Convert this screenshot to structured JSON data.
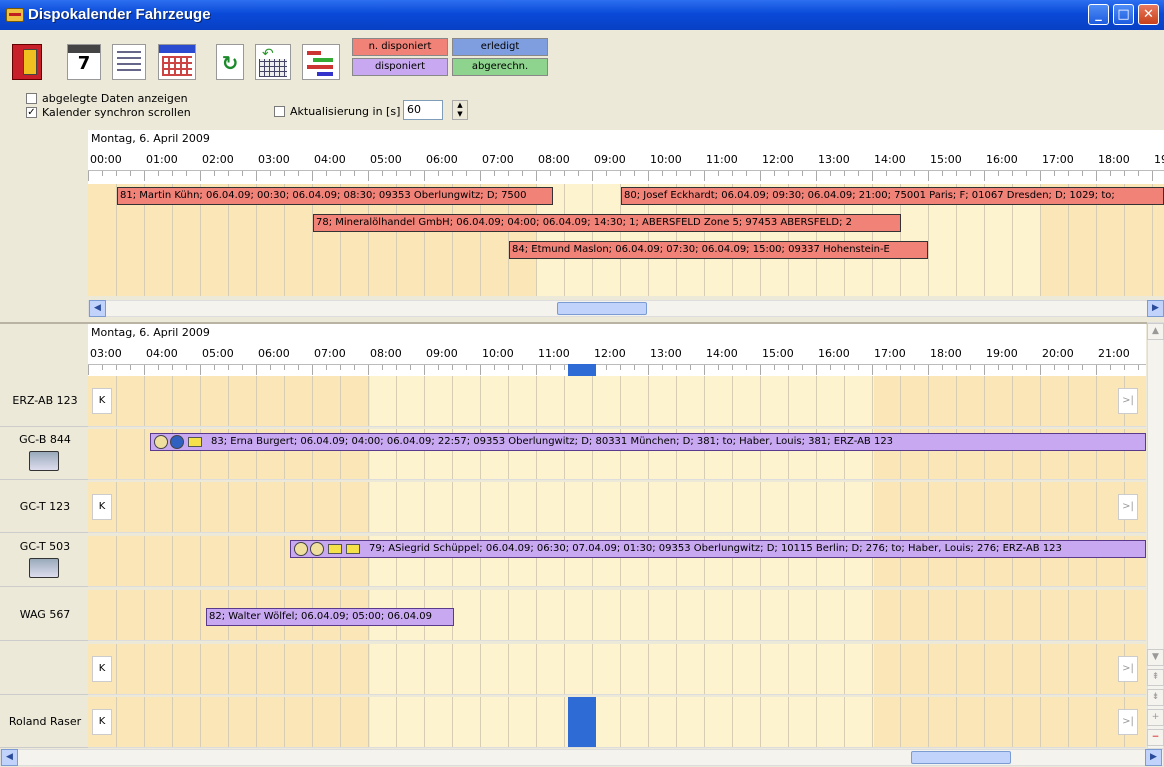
{
  "window": {
    "title": "Dispokalender Fahrzeuge"
  },
  "legend": {
    "not_dispatched": "n. disponiert",
    "done": "erledigt",
    "dispatched": "disponiert",
    "billed": "abgerechn.",
    "colors": {
      "not_dispatched": "#f08278",
      "done": "#7f9ee0",
      "dispatched": "#c8a8f0",
      "billed": "#8ed48e"
    }
  },
  "options": {
    "show_archived_label": "abgelegte Daten anzeigen",
    "show_archived": false,
    "sync_scroll_label": "Kalender synchron scrollen",
    "sync_scroll": true,
    "refresh_label": "Aktualisierung in [s]",
    "refresh_enabled": false,
    "refresh_value": "60"
  },
  "top_calendar": {
    "date": "Montag, 6. April 2009",
    "hours": [
      "00:00",
      "01:00",
      "02:00",
      "03:00",
      "04:00",
      "05:00",
      "06:00",
      "07:00",
      "08:00",
      "09:00",
      "10:00",
      "11:00",
      "12:00",
      "13:00",
      "14:00",
      "15:00",
      "16:00",
      "17:00",
      "18:00",
      "19"
    ],
    "events": [
      {
        "text": "81; Martin Kühn; 06.04.09; 00:30; 06.04.09; 08:30; 09353 Oberlungwitz; D; 7500"
      },
      {
        "text": "80; Josef Eckhardt; 06.04.09; 09:30; 06.04.09; 21:00; 75001 Paris; F; 01067 Dresden; D; 1029; to;"
      },
      {
        "text": "78; Mineralölhandel GmbH; 06.04.09; 04:00; 06.04.09; 14:30; 1; ABERSFELD Zone 5; 97453 ABERSFELD; 2"
      },
      {
        "text": "84; Etmund Maslon; 06.04.09; 07:30; 06.04.09; 15:00; 09337 Hohenstein-E"
      }
    ]
  },
  "bottom_calendar": {
    "date": "Montag, 6. April 2009",
    "hours": [
      "03:00",
      "04:00",
      "05:00",
      "06:00",
      "07:00",
      "08:00",
      "09:00",
      "10:00",
      "11:00",
      "12:00",
      "13:00",
      "14:00",
      "15:00",
      "16:00",
      "17:00",
      "18:00",
      "19:00",
      "20:00",
      "21:00"
    ],
    "rows": [
      {
        "label": "ERZ-AB 123",
        "event": ""
      },
      {
        "label": "GC-B 844",
        "event": "83; Erna Burgert; 06.04.09; 04:00; 06.04.09; 22:57; 09353 Oberlungwitz; D; 80331 München; D; 381; to; Haber, Louis; 381; ERZ-AB 123"
      },
      {
        "label": "GC-T 123",
        "event": ""
      },
      {
        "label": "GC-T 503",
        "event": "79; ASiegrid Schüppel; 06.04.09; 06:30; 07.04.09; 01:30; 09353 Oberlungwitz; D; 10115 Berlin; D; 276; to; Haber, Louis; 276; ERZ-AB 123"
      },
      {
        "label": "WAG 567",
        "event": "82; Walter Wölfel; 06.04.09; 05:00; 06.04.09"
      },
      {
        "label": "",
        "event": ""
      },
      {
        "label": "Roland Raser",
        "event": ""
      }
    ],
    "nav_first": "K",
    "nav_last": ">|"
  }
}
